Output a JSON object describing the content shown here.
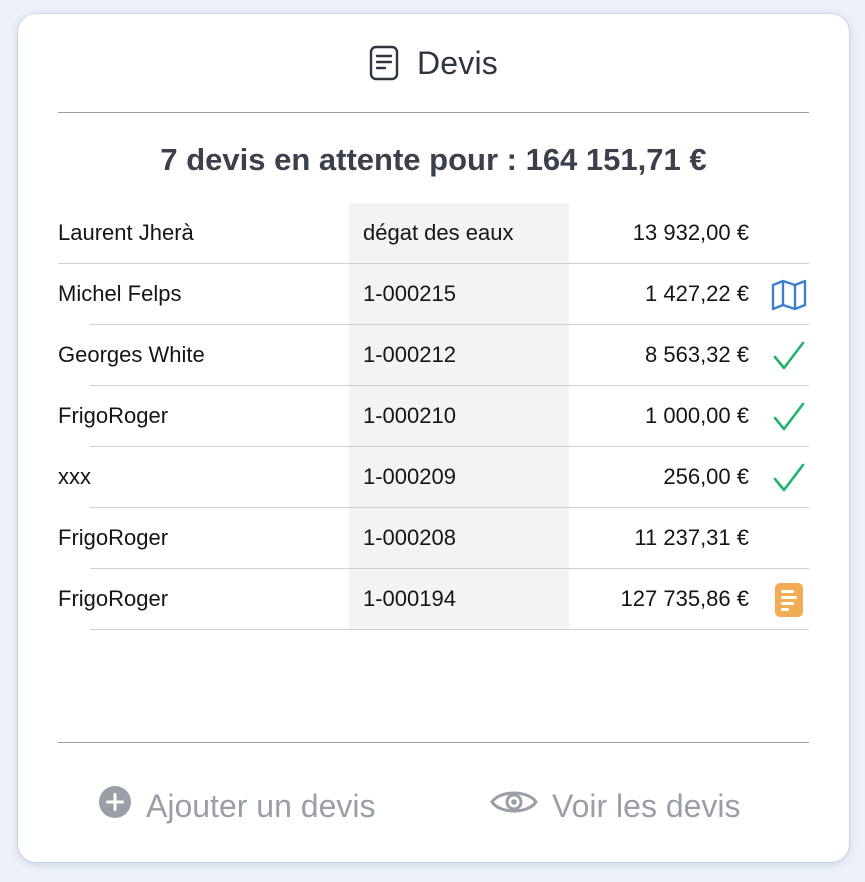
{
  "header": {
    "title": "Devis",
    "icon": "document-icon"
  },
  "summary": {
    "text": "7 devis en attente pour : 164 151,71 €"
  },
  "rows": [
    {
      "name": "Laurent Jherà",
      "ref": "dégat des eaux",
      "amount": "13 932,00 €",
      "icon": ""
    },
    {
      "name": "Michel Felps",
      "ref": "1-000215",
      "amount": "1 427,22 €",
      "icon": "map-icon"
    },
    {
      "name": "Georges White",
      "ref": "1-000212",
      "amount": "8 563,32 €",
      "icon": "checkmark-icon"
    },
    {
      "name": "FrigoRoger",
      "ref": "1-000210",
      "amount": "1 000,00 €",
      "icon": "checkmark-icon"
    },
    {
      "name": "xxx",
      "ref": "1-000209",
      "amount": "256,00 €",
      "icon": "checkmark-icon"
    },
    {
      "name": "FrigoRoger",
      "ref": "1-000208",
      "amount": "11 237,31 €",
      "icon": ""
    },
    {
      "name": "FrigoRoger",
      "ref": "1-000194",
      "amount": "127 735,86 €",
      "icon": "document-orange-icon"
    }
  ],
  "footer": {
    "add_label": "Ajouter un devis",
    "view_label": "Voir les devis"
  },
  "colors": {
    "text_dark": "#2f3441",
    "map_blue": "#3d7fd1",
    "check_green": "#1fb36b",
    "doc_orange": "#f2ac55",
    "footer_gray": "#9a9ea6"
  }
}
